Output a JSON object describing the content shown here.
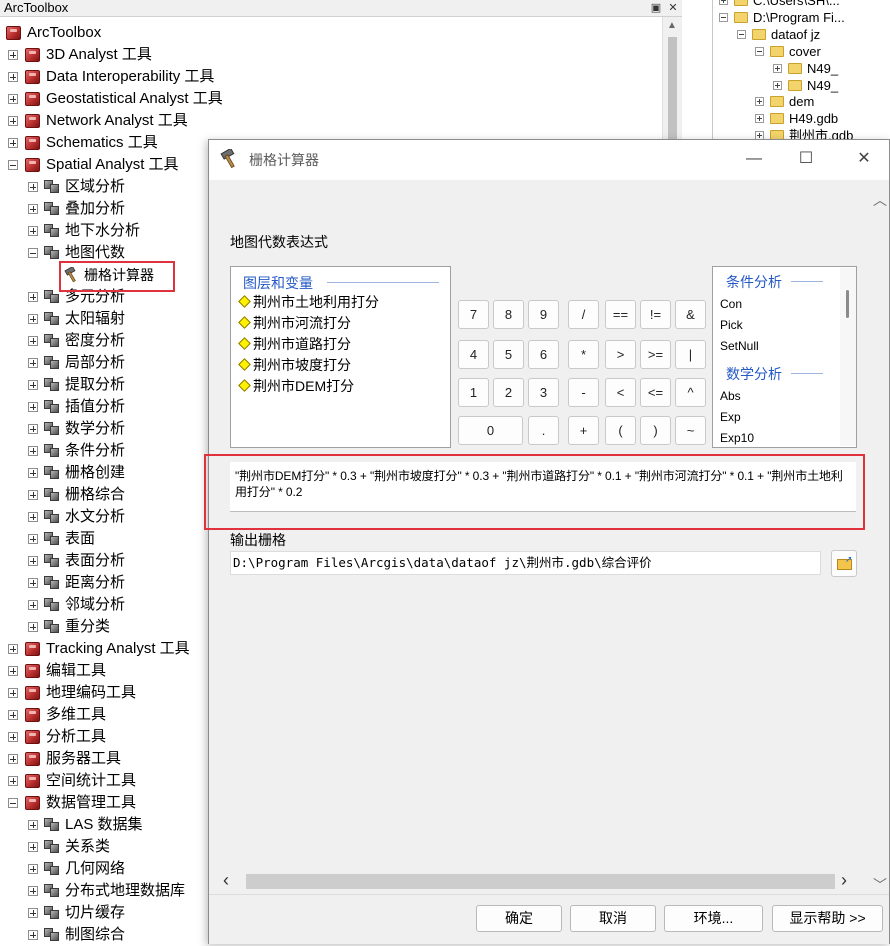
{
  "toolbox": {
    "title": "ArcToolbox",
    "root_label": "ArcToolbox",
    "items": [
      {
        "label": "3D Analyst 工具"
      },
      {
        "label": "Data Interoperability 工具"
      },
      {
        "label": "Geostatistical Analyst 工具"
      },
      {
        "label": "Network Analyst 工具"
      },
      {
        "label": "Schematics 工具"
      },
      {
        "label": "Spatial Analyst 工具"
      },
      {
        "label": "区域分析"
      },
      {
        "label": "叠加分析"
      },
      {
        "label": "地下水分析"
      },
      {
        "label": "地图代数"
      },
      {
        "label": "栅格计算器"
      },
      {
        "label": "多元分析"
      },
      {
        "label": "太阳辐射"
      },
      {
        "label": "密度分析"
      },
      {
        "label": "局部分析"
      },
      {
        "label": "提取分析"
      },
      {
        "label": "插值分析"
      },
      {
        "label": "数学分析"
      },
      {
        "label": "条件分析"
      },
      {
        "label": "栅格创建"
      },
      {
        "label": "栅格综合"
      },
      {
        "label": "水文分析"
      },
      {
        "label": "表面"
      },
      {
        "label": "表面分析"
      },
      {
        "label": "距离分析"
      },
      {
        "label": "邻域分析"
      },
      {
        "label": "重分类"
      },
      {
        "label": "Tracking Analyst 工具"
      },
      {
        "label": "编辑工具"
      },
      {
        "label": "地理编码工具"
      },
      {
        "label": "多维工具"
      },
      {
        "label": "分析工具"
      },
      {
        "label": "服务器工具"
      },
      {
        "label": "空间统计工具"
      },
      {
        "label": "数据管理工具"
      },
      {
        "label": "LAS 数据集"
      },
      {
        "label": "关系类"
      },
      {
        "label": "几何网络"
      },
      {
        "label": "分布式地理数据库"
      },
      {
        "label": "切片缓存"
      },
      {
        "label": "制图综合"
      }
    ]
  },
  "catalog": {
    "items": [
      {
        "label": "C:\\Users\\SH\\..."
      },
      {
        "label": "D:\\Program Fi..."
      },
      {
        "label": "dataof jz"
      },
      {
        "label": "cover"
      },
      {
        "label": "N49_"
      },
      {
        "label": "N49_"
      },
      {
        "label": "dem"
      },
      {
        "label": "H49.gdb"
      },
      {
        "label": "荆州市.gdb"
      }
    ]
  },
  "dialog": {
    "title": "栅格计算器",
    "map_algebra_label": "地图代数表达式",
    "layers_header": "图层和变量",
    "layers": [
      "荆州市土地利用打分",
      "荆州市河流打分",
      "荆州市道路打分",
      "荆州市坡度打分",
      "荆州市DEM打分"
    ],
    "calculator_keys": [
      [
        "7",
        "8",
        "9",
        "/",
        "==",
        "!=",
        "&"
      ],
      [
        "4",
        "5",
        "6",
        "*",
        ">",
        ">=",
        "|"
      ],
      [
        "1",
        "2",
        "3",
        "-",
        "<",
        "<=",
        "^"
      ],
      [
        "0",
        ".",
        "+",
        "(",
        ")",
        "~"
      ]
    ],
    "functions": {
      "header1": "条件分析",
      "conditional": [
        "Con",
        "Pick",
        "SetNull"
      ],
      "header2": "数学分析",
      "math": [
        "Abs",
        "Exp",
        "Exp10"
      ]
    },
    "expression": "\"荆州市DEM打分\" * 0.3 + \"荆州市坡度打分\" * 0.3 + \"荆州市道路打分\" * 0.1 + \"荆州市河流打分\" * 0.1 + \"荆州市土地利用打分\" * 0.2",
    "output_label": "输出栅格",
    "output_value": "D:\\Program Files\\Arcgis\\data\\dataof jz\\荆州市.gdb\\综合评价",
    "buttons": {
      "ok": "确定",
      "cancel": "取消",
      "env": "环境...",
      "help": "显示帮助 >>"
    },
    "window_controls": {
      "minimize": "—",
      "maximize": "☐",
      "close": "✕"
    }
  },
  "colors": {
    "highlight_outline": "#e0323c",
    "header_blue": "#2459c6",
    "diamond_yellow": "#fff200"
  }
}
